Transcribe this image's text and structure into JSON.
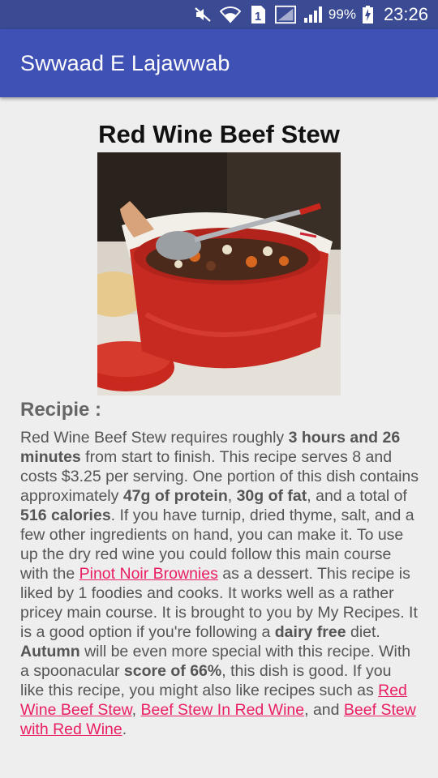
{
  "status_bar": {
    "battery_percent": "99%",
    "time": "23:26",
    "sim_label": "1",
    "icons": [
      "mute-icon",
      "wifi-icon",
      "sim-icon",
      "signal-icon",
      "signal-icon",
      "battery-charging-icon"
    ]
  },
  "app_bar": {
    "title": "Swwaad E Lajawwab"
  },
  "recipe": {
    "title": "Red Wine Beef Stew",
    "image_subject": "red-pot-beef-stew-photo",
    "section_heading": "Recipie :",
    "body": [
      {
        "t": "Red Wine Beef Stew requires roughly "
      },
      {
        "t": "3 hours and 26 minutes",
        "b": true
      },
      {
        "t": " from start to finish. This recipe serves 8 and costs $3.25 per serving. One portion of this dish contains approximately "
      },
      {
        "t": "47g of protein",
        "b": true
      },
      {
        "t": ", "
      },
      {
        "t": "30g of fat",
        "b": true
      },
      {
        "t": ", and a total of "
      },
      {
        "t": "516 calories",
        "b": true
      },
      {
        "t": ". If you have turnip, dried thyme, salt, and a few other ingredients on hand, you can make it. To use up the dry red wine you could follow this main course with the "
      },
      {
        "t": "Pinot Noir Brownies",
        "link": true,
        "name": "link-pinot-noir-brownies"
      },
      {
        "t": " as a dessert. This recipe is liked by 1 foodies and cooks. It works well as a rather pricey main course. It is brought to you by My Recipes. It is a good option if you're following a "
      },
      {
        "t": "dairy free",
        "b": true
      },
      {
        "t": " diet. "
      },
      {
        "t": "Autumn",
        "b": true
      },
      {
        "t": " will be even more special with this recipe. With a spoonacular "
      },
      {
        "t": "score of 66%",
        "b": true
      },
      {
        "t": ", this dish is good. If you like this recipe, you might also like recipes such as "
      },
      {
        "t": "Red Wine Beef Stew",
        "link": true,
        "name": "link-red-wine-beef-stew"
      },
      {
        "t": ", "
      },
      {
        "t": "Beef Stew In Red Wine",
        "link": true,
        "name": "link-beef-stew-in-red-wine"
      },
      {
        "t": ", and "
      },
      {
        "t": "Beef Stew with Red Wine",
        "link": true,
        "name": "link-beef-stew-with-red-wine"
      },
      {
        "t": "."
      }
    ]
  },
  "colors": {
    "status_bar": "#3a4a93",
    "app_bar": "#3f51b5",
    "background": "#eeeeee",
    "link": "#e91e63",
    "body_text": "#555555"
  }
}
